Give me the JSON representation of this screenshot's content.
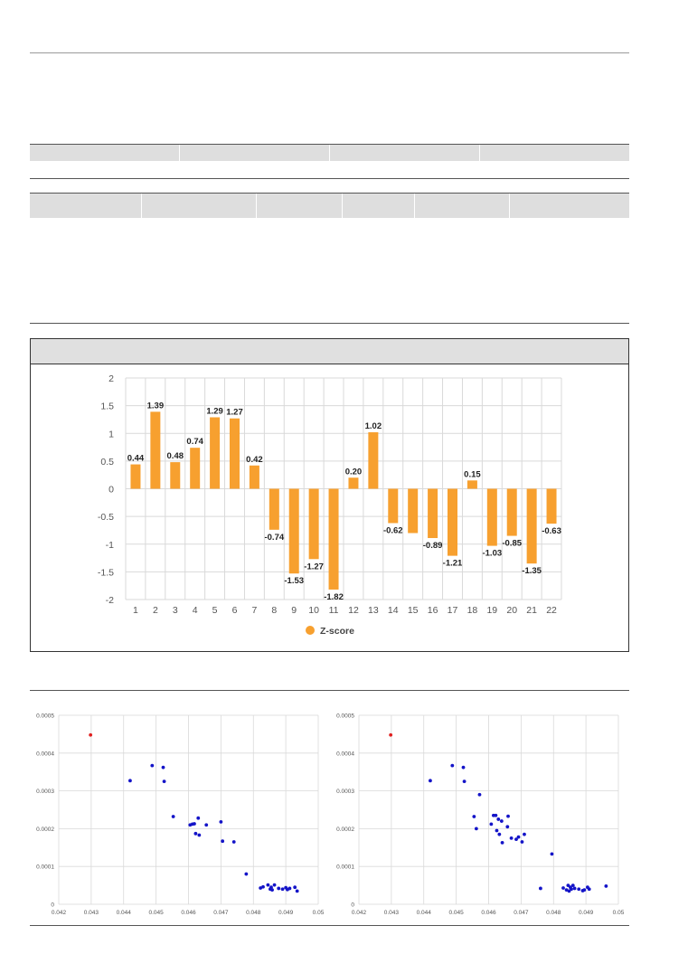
{
  "colors": {
    "bar": "#F7A02F",
    "bar_label": "#222222",
    "axis_text": "#555555",
    "scatter_point": "#1414C8",
    "scatter_highlight": "#E02020",
    "grid": "#D9D9D9"
  },
  "chart_data": [
    {
      "type": "bar",
      "categories": [
        "1",
        "2",
        "3",
        "4",
        "5",
        "6",
        "7",
        "8",
        "9",
        "10",
        "11",
        "12",
        "13",
        "14",
        "15",
        "16",
        "17",
        "18",
        "19",
        "20",
        "21",
        "22"
      ],
      "series": [
        {
          "name": "Z-score",
          "values": [
            0.44,
            1.39,
            0.48,
            0.74,
            1.29,
            1.27,
            0.42,
            -0.74,
            -1.53,
            -1.27,
            -1.82,
            0.2,
            1.02,
            -0.62,
            -0.8,
            -0.89,
            -1.21,
            0.15,
            -1.03,
            -0.85,
            -1.35,
            -0.63
          ],
          "labels": [
            "0.44",
            "1.39",
            "0.48",
            "0.74",
            "1.29",
            "1.27",
            "0.42",
            "-0.74",
            "-1.53",
            "-1.27",
            "-1.82",
            "0.20",
            "1.02",
            "-0.62",
            "",
            "-0.89",
            "-1.21",
            "0.15",
            "-1.03",
            "-0.85",
            "-1.35",
            "-0.63"
          ]
        }
      ],
      "ylim": [
        -2,
        2
      ],
      "yticks": [
        2,
        1.5,
        1,
        0.5,
        0,
        -0.5,
        -1,
        -1.5,
        -2
      ],
      "ytick_labels": [
        "2",
        "1.5",
        "1",
        "0.5",
        "0",
        "-0.5",
        "-1",
        "-1.5",
        "-2"
      ],
      "legend": "bottom",
      "grid": true
    },
    {
      "type": "scatter",
      "xlim": [
        0.042,
        0.05
      ],
      "ylim": [
        0,
        0.0005
      ],
      "xticks": [
        "0.042",
        "0.043",
        "0.044",
        "0.045",
        "0.046",
        "0.047",
        "0.048",
        "0.049",
        "0.05"
      ],
      "yticks": [
        "0",
        "0.0001",
        "0.0002",
        "0.0003",
        "0.0004",
        "0.0005"
      ],
      "grid": true,
      "highlight": [
        {
          "x": 0.04298,
          "y": 0.000448
        }
      ],
      "points": [
        {
          "x": 0.0442,
          "y": 0.000327
        },
        {
          "x": 0.04488,
          "y": 0.000367
        },
        {
          "x": 0.04522,
          "y": 0.000362
        },
        {
          "x": 0.04525,
          "y": 0.000325
        },
        {
          "x": 0.04553,
          "y": 0.000232
        },
        {
          "x": 0.04605,
          "y": 0.00021
        },
        {
          "x": 0.04612,
          "y": 0.000212
        },
        {
          "x": 0.04618,
          "y": 0.000213
        },
        {
          "x": 0.04622,
          "y": 0.000187
        },
        {
          "x": 0.0463,
          "y": 0.000228
        },
        {
          "x": 0.04633,
          "y": 0.000183
        },
        {
          "x": 0.04655,
          "y": 0.00021
        },
        {
          "x": 0.047,
          "y": 0.000218
        },
        {
          "x": 0.04705,
          "y": 0.000167
        },
        {
          "x": 0.0474,
          "y": 0.000165
        },
        {
          "x": 0.04778,
          "y": 8e-05
        },
        {
          "x": 0.04822,
          "y": 4.3e-05
        },
        {
          "x": 0.0483,
          "y": 4.6e-05
        },
        {
          "x": 0.04845,
          "y": 5.1e-05
        },
        {
          "x": 0.04852,
          "y": 4e-05
        },
        {
          "x": 0.04855,
          "y": 4.5e-05
        },
        {
          "x": 0.04858,
          "y": 3.8e-05
        },
        {
          "x": 0.04865,
          "y": 5.1e-05
        },
        {
          "x": 0.04878,
          "y": 4.2e-05
        },
        {
          "x": 0.0489,
          "y": 4e-05
        },
        {
          "x": 0.049,
          "y": 4.4e-05
        },
        {
          "x": 0.04905,
          "y": 3.9e-05
        },
        {
          "x": 0.04912,
          "y": 4.2e-05
        },
        {
          "x": 0.04928,
          "y": 4.5e-05
        },
        {
          "x": 0.04935,
          "y": 3.5e-05
        }
      ]
    },
    {
      "type": "scatter",
      "xlim": [
        0.042,
        0.05
      ],
      "ylim": [
        0,
        0.0005
      ],
      "xticks": [
        "0.042",
        "0.043",
        "0.044",
        "0.045",
        "0.046",
        "0.047",
        "0.048",
        "0.049",
        "0.05"
      ],
      "yticks": [
        "0",
        "0.0001",
        "0.0002",
        "0.0003",
        "0.0004",
        "0.0005"
      ],
      "grid": true,
      "highlight": [
        {
          "x": 0.04298,
          "y": 0.000448
        }
      ],
      "points": [
        {
          "x": 0.0442,
          "y": 0.000327
        },
        {
          "x": 0.04488,
          "y": 0.000367
        },
        {
          "x": 0.04522,
          "y": 0.000362
        },
        {
          "x": 0.04525,
          "y": 0.000325
        },
        {
          "x": 0.04555,
          "y": 0.000232
        },
        {
          "x": 0.04562,
          "y": 0.0002
        },
        {
          "x": 0.04572,
          "y": 0.00029
        },
        {
          "x": 0.04608,
          "y": 0.000212
        },
        {
          "x": 0.04615,
          "y": 0.000235
        },
        {
          "x": 0.04622,
          "y": 0.000235
        },
        {
          "x": 0.04625,
          "y": 0.000195
        },
        {
          "x": 0.0463,
          "y": 0.000225
        },
        {
          "x": 0.04633,
          "y": 0.000185
        },
        {
          "x": 0.0464,
          "y": 0.00022
        },
        {
          "x": 0.04642,
          "y": 0.000163
        },
        {
          "x": 0.04658,
          "y": 0.000205
        },
        {
          "x": 0.0466,
          "y": 0.000233
        },
        {
          "x": 0.0467,
          "y": 0.000175
        },
        {
          "x": 0.04685,
          "y": 0.000172
        },
        {
          "x": 0.04692,
          "y": 0.000178
        },
        {
          "x": 0.04703,
          "y": 0.000165
        },
        {
          "x": 0.0471,
          "y": 0.000185
        },
        {
          "x": 0.0476,
          "y": 4.2e-05
        },
        {
          "x": 0.04795,
          "y": 0.000133
        },
        {
          "x": 0.0483,
          "y": 4.3e-05
        },
        {
          "x": 0.0484,
          "y": 3.8e-05
        },
        {
          "x": 0.04845,
          "y": 5e-05
        },
        {
          "x": 0.04848,
          "y": 3.5e-05
        },
        {
          "x": 0.04852,
          "y": 4.5e-05
        },
        {
          "x": 0.04855,
          "y": 4e-05
        },
        {
          "x": 0.0486,
          "y": 5e-05
        },
        {
          "x": 0.04865,
          "y": 4.2e-05
        },
        {
          "x": 0.04878,
          "y": 4e-05
        },
        {
          "x": 0.0489,
          "y": 3.6e-05
        },
        {
          "x": 0.04895,
          "y": 3.8e-05
        },
        {
          "x": 0.04905,
          "y": 4.5e-05
        },
        {
          "x": 0.0491,
          "y": 4e-05
        },
        {
          "x": 0.04962,
          "y": 4.8e-05
        }
      ]
    }
  ]
}
